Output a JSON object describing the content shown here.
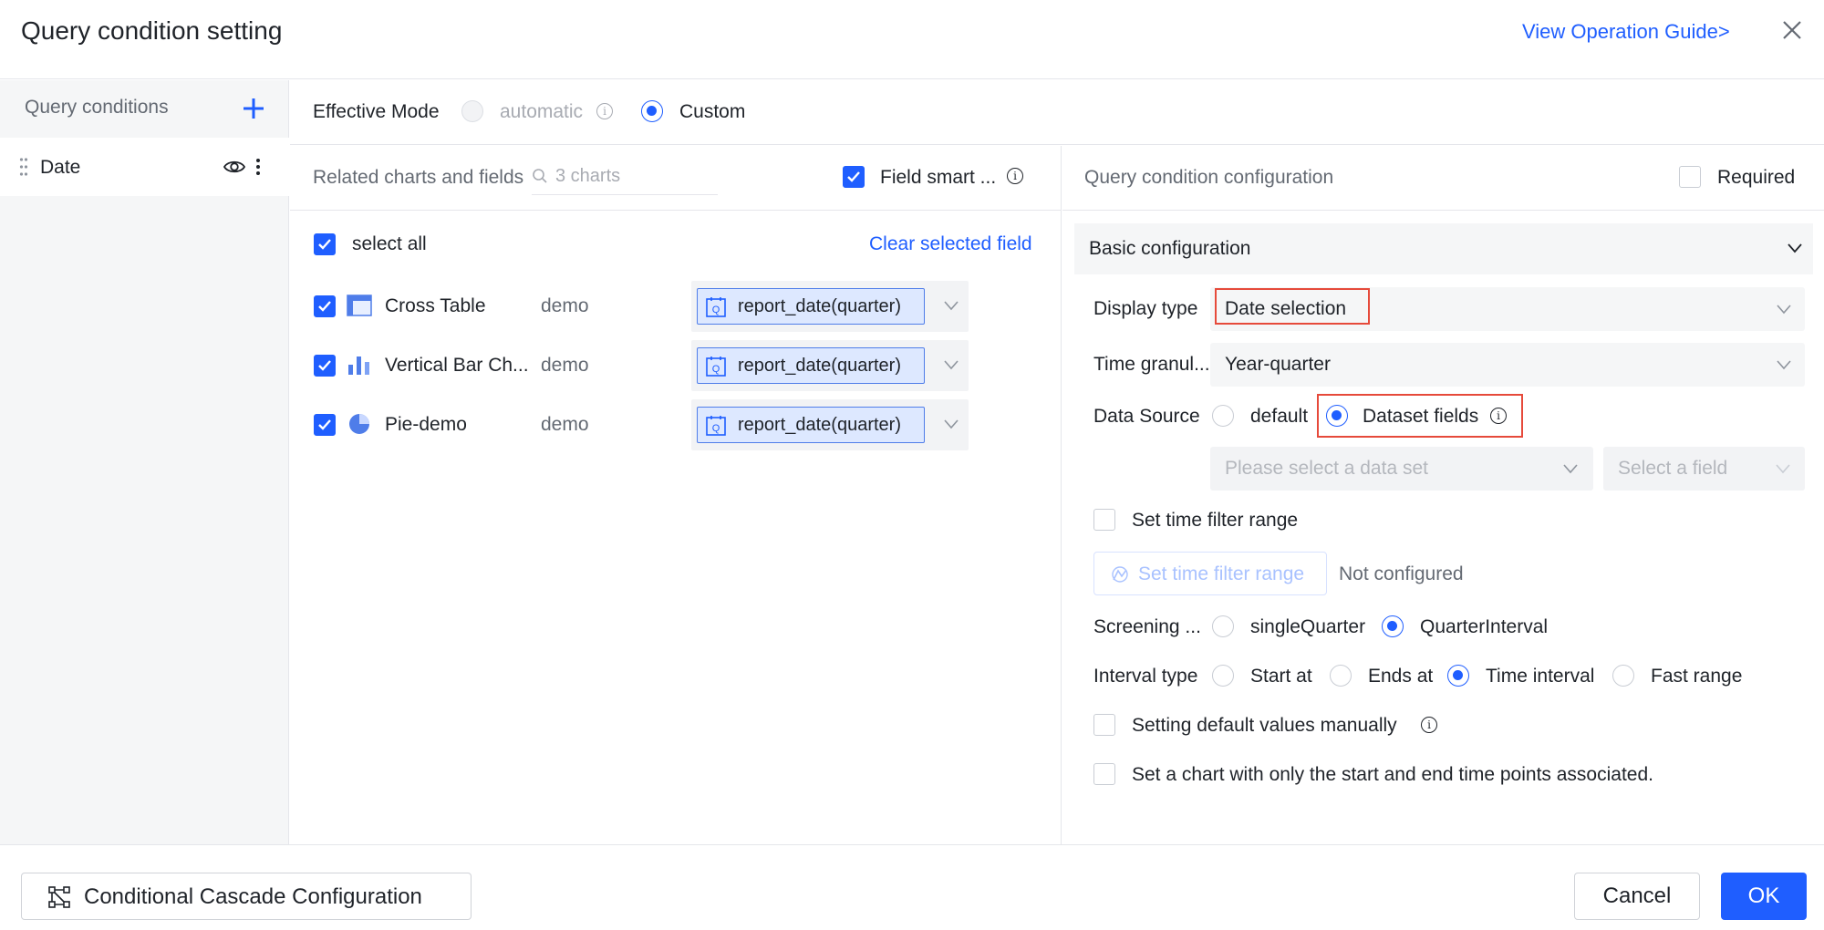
{
  "dialog": {
    "title": "Query condition setting",
    "guide_link": "View Operation Guide>"
  },
  "sidebar": {
    "title": "Query conditions",
    "items": [
      {
        "label": "Date"
      }
    ]
  },
  "mode": {
    "label": "Effective Mode",
    "options": [
      {
        "label": "automatic",
        "selected": false,
        "disabled": true
      },
      {
        "label": "Custom",
        "selected": true,
        "disabled": false
      }
    ]
  },
  "related": {
    "header": "Related charts and fields",
    "search_placeholder": "3 charts",
    "field_smart_label": "Field smart ...",
    "field_smart_checked": true,
    "select_all_label": "select all",
    "select_all_checked": true,
    "clear_link": "Clear selected field",
    "charts": [
      {
        "name": "Cross Table",
        "dataset": "demo",
        "field": "report_date(quarter)",
        "checked": true,
        "icon": "table-icon"
      },
      {
        "name": "Vertical Bar Ch...",
        "dataset": "demo",
        "field": "report_date(quarter)",
        "checked": true,
        "icon": "bar-chart-icon"
      },
      {
        "name": "Pie-demo",
        "dataset": "demo",
        "field": "report_date(quarter)",
        "checked": true,
        "icon": "pie-chart-icon"
      }
    ]
  },
  "config": {
    "header": "Query condition configuration",
    "required_label": "Required",
    "required_checked": false,
    "section_title": "Basic configuration",
    "display_type": {
      "label": "Display type",
      "value": "Date selection"
    },
    "time_granularity": {
      "label": "Time granul...",
      "value": "Year-quarter"
    },
    "data_source": {
      "label": "Data Source",
      "options": [
        {
          "label": "default",
          "selected": false
        },
        {
          "label": "Dataset fields",
          "selected": true
        }
      ],
      "dataset_placeholder": "Please select a data set",
      "field_placeholder": "Select a field"
    },
    "time_filter": {
      "checkbox_label": "Set time filter range",
      "checked": false,
      "button_label": "Set time filter range",
      "status": "Not configured"
    },
    "screening": {
      "label": "Screening ...",
      "options": [
        {
          "label": "singleQuarter",
          "selected": false
        },
        {
          "label": "QuarterInterval",
          "selected": true
        }
      ]
    },
    "interval_type": {
      "label": "Interval type",
      "options": [
        {
          "label": "Start at",
          "selected": false
        },
        {
          "label": "Ends at",
          "selected": false
        },
        {
          "label": "Time interval",
          "selected": true
        },
        {
          "label": "Fast range",
          "selected": false
        }
      ]
    },
    "default_values": {
      "label": "Setting default values manually",
      "checked": false
    },
    "start_end_chart": {
      "label": "Set a chart with only the start and end time points associated.",
      "checked": false
    }
  },
  "footer": {
    "cascade_label": "Conditional Cascade Configuration",
    "cancel_label": "Cancel",
    "ok_label": "OK"
  },
  "colors": {
    "accent": "#1f5eff",
    "highlight_box": "#e64a3b",
    "sidebar_bg": "#f5f6f7",
    "field_tag_bg": "#dde8ff"
  }
}
